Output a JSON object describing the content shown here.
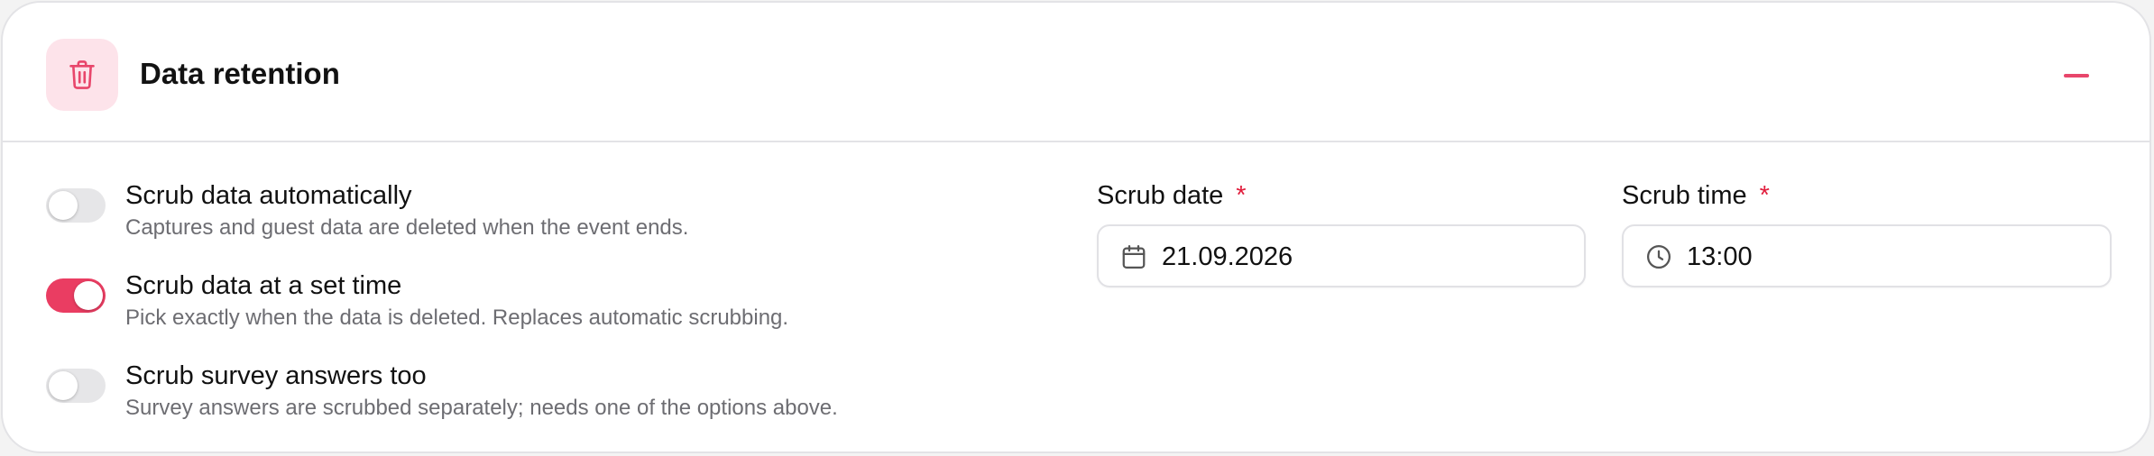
{
  "section": {
    "title": "Data retention",
    "icon": "trash-icon",
    "accent_color": "#ea3d62",
    "icon_bg_color": "#fde3ea",
    "collapse_icon": "minus-icon"
  },
  "options": [
    {
      "label": "Scrub data automatically",
      "description": "Captures and guest data are deleted when the event ends.",
      "enabled": false
    },
    {
      "label": "Scrub data at a set time",
      "description": "Pick exactly when the data is deleted. Replaces automatic scrubbing.",
      "enabled": true
    },
    {
      "label": "Scrub survey answers too",
      "description": "Survey answers are scrubbed separately; needs one of the options above.",
      "enabled": false
    }
  ],
  "scrub_date": {
    "label": "Scrub date",
    "required_marker": "*",
    "value": "21.09.2026",
    "icon": "calendar-icon"
  },
  "scrub_time": {
    "label": "Scrub time",
    "required_marker": "*",
    "value": "13:00",
    "icon": "clock-icon"
  }
}
